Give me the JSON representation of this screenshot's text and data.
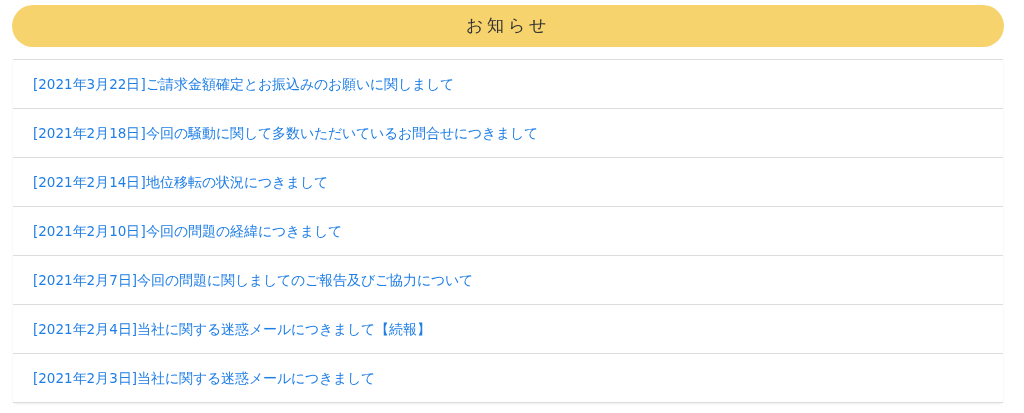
{
  "header": {
    "title": "お知らせ"
  },
  "notices": [
    {
      "text": "[2021年3月22日]ご請求金額確定とお振込みのお願いに関しまして"
    },
    {
      "text": "[2021年2月18日]今回の騒動に関して多数いただいているお問合せにつきまして"
    },
    {
      "text": "[2021年2月14日]地位移転の状況につきまして"
    },
    {
      "text": "[2021年2月10日]今回の問題の経緯につきまして"
    },
    {
      "text": "[2021年2月7日]今回の問題に関しましてのご報告及びご協力について"
    },
    {
      "text": "[2021年2月4日]当社に関する迷惑メールにつきまして【続報】"
    },
    {
      "text": "[2021年2月3日]当社に関する迷惑メールにつきまして"
    }
  ]
}
